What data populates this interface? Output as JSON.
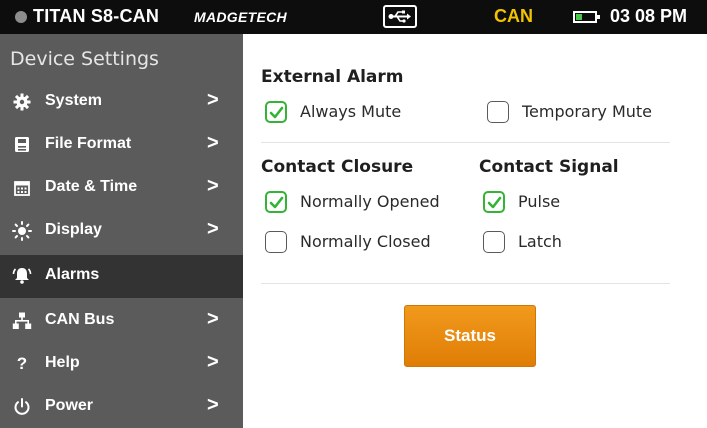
{
  "topbar": {
    "device_name": "TITAN S8-CAN",
    "brand": "MADGETECH",
    "connection_status": "CAN",
    "time": "03 08 PM",
    "icons": [
      "device-status-dot",
      "usb-icon",
      "battery-icon"
    ],
    "status_color": "#f2c200"
  },
  "sidebar": {
    "title": "Device Settings",
    "items": [
      {
        "label": "System",
        "icon": "gear-icon",
        "chevron": ">"
      },
      {
        "label": "File Format",
        "icon": "file-icon",
        "chevron": ">"
      },
      {
        "label": "Date & Time",
        "icon": "calendar-icon",
        "chevron": ">"
      },
      {
        "label": "Display",
        "icon": "brightness-icon",
        "chevron": ">"
      },
      {
        "label": "Alarms",
        "icon": "bell-icon",
        "active": true
      },
      {
        "label": "CAN Bus",
        "icon": "network-icon",
        "chevron": ">"
      },
      {
        "label": "Help",
        "icon": "question-icon",
        "glyph": "?",
        "chevron": ">"
      },
      {
        "label": "Power",
        "icon": "power-icon",
        "chevron": ">"
      }
    ]
  },
  "main": {
    "external_alarm": {
      "title": "External Alarm",
      "always_mute": {
        "label": "Always Mute",
        "checked": true
      },
      "temporary_mute": {
        "label": "Temporary Mute",
        "checked": false
      }
    },
    "contact_closure": {
      "title": "Contact Closure",
      "normally_opened": {
        "label": "Normally Opened",
        "checked": true
      },
      "normally_closed": {
        "label": "Normally Closed",
        "checked": false
      }
    },
    "contact_signal": {
      "title": "Contact Signal",
      "pulse": {
        "label": "Pulse",
        "checked": true
      },
      "latch": {
        "label": "Latch",
        "checked": false
      }
    },
    "status_button": {
      "label": "Status",
      "color": "#ef8e14"
    }
  }
}
